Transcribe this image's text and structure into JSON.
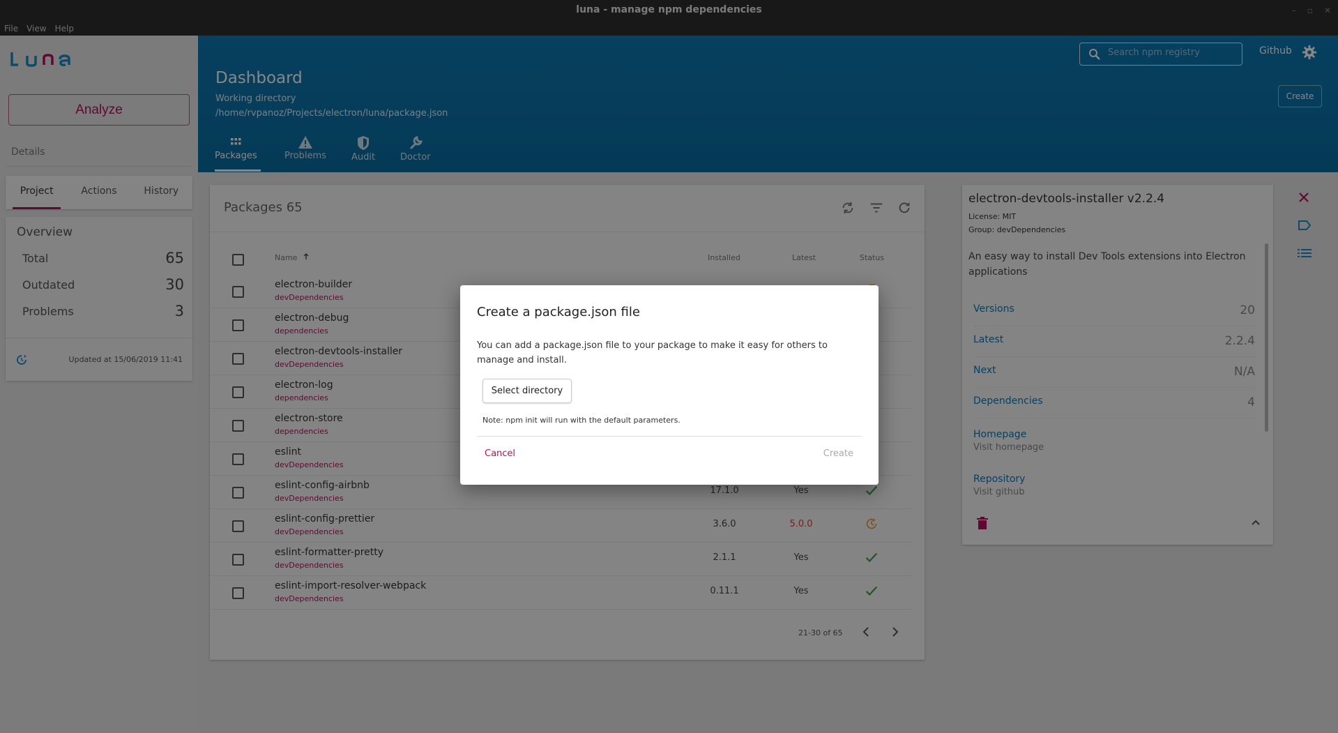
{
  "window": {
    "title": "luna - manage npm dependencies",
    "controls": [
      "–",
      "▫",
      "✕"
    ]
  },
  "menubar": {
    "items": [
      "File",
      "View",
      "Help"
    ]
  },
  "sidebar": {
    "logo": "Luna",
    "analyze_label": "Analyze",
    "details_label": "Details",
    "tabs": [
      {
        "label": "Project",
        "active": true
      },
      {
        "label": "Actions"
      },
      {
        "label": "History"
      }
    ],
    "overview": {
      "title": "Overview",
      "rows": [
        {
          "label": "Total",
          "value": "65"
        },
        {
          "label": "Outdated",
          "value": "30"
        },
        {
          "label": "Problems",
          "value": "3"
        }
      ],
      "updated": "Updated at 15/06/2019 11:41"
    }
  },
  "header": {
    "title": "Dashboard",
    "working_dir_label": "Working directory",
    "working_dir_path": "/home/rvpanoz/Projects/electron/luna/package.json",
    "search_placeholder": "Search npm registry",
    "github_label": "Github",
    "create_label": "Create",
    "tabs": [
      {
        "label": "Packages",
        "active": true
      },
      {
        "label": "Problems"
      },
      {
        "label": "Audit"
      },
      {
        "label": "Doctor"
      }
    ]
  },
  "packages": {
    "title": "Packages 65",
    "columns": {
      "name": "Name",
      "installed": "Installed",
      "latest": "Latest",
      "status": "Status"
    },
    "rows": [
      {
        "name": "electron-builder",
        "group": "devDependencies",
        "installed": "",
        "latest": "",
        "status": "outdated"
      },
      {
        "name": "electron-debug",
        "group": "dependencies",
        "installed": "",
        "latest": "",
        "status": "outdated"
      },
      {
        "name": "electron-devtools-installer",
        "group": "devDependencies",
        "installed": "",
        "latest": "",
        "status": "ok"
      },
      {
        "name": "electron-log",
        "group": "dependencies",
        "installed": "",
        "latest": "",
        "status": "outdated"
      },
      {
        "name": "electron-store",
        "group": "dependencies",
        "installed": "",
        "latest": "",
        "status": "outdated"
      },
      {
        "name": "eslint",
        "group": "devDependencies",
        "installed": "",
        "latest": "",
        "status": "ok"
      },
      {
        "name": "eslint-config-airbnb",
        "group": "devDependencies",
        "installed": "17.1.0",
        "latest": "Yes",
        "status": "ok"
      },
      {
        "name": "eslint-config-prettier",
        "group": "devDependencies",
        "installed": "3.6.0",
        "latest": "5.0.0",
        "status": "outdated"
      },
      {
        "name": "eslint-formatter-pretty",
        "group": "devDependencies",
        "installed": "2.1.1",
        "latest": "Yes",
        "status": "ok"
      },
      {
        "name": "eslint-import-resolver-webpack",
        "group": "devDependencies",
        "installed": "0.11.1",
        "latest": "Yes",
        "status": "ok"
      }
    ],
    "pager": "21-30 of 65"
  },
  "detail": {
    "title": "electron-devtools-installer v2.2.4",
    "license": "License: MIT",
    "group": "Group: devDependencies",
    "description": "An easy way to install Dev Tools extensions into Electron applications",
    "stats": [
      {
        "label": "Versions",
        "value": "20"
      },
      {
        "label": "Latest",
        "value": "2.2.4"
      },
      {
        "label": "Next",
        "value": "N/A"
      },
      {
        "label": "Dependencies",
        "value": "4"
      }
    ],
    "links": [
      {
        "label": "Homepage",
        "value": "Visit homepage"
      },
      {
        "label": "Repository",
        "value": "Visit github"
      }
    ]
  },
  "dialog": {
    "title": "Create a package.json file",
    "message": "You can add a package.json file to your package to make it easy for others to manage and install.",
    "select_label": "Select directory",
    "note": "Note: npm init will run with the default parameters.",
    "cancel_label": "Cancel",
    "create_label": "Create"
  },
  "colors": {
    "accent": "#b3125d",
    "header": "#0e79b4",
    "ok": "#43a047",
    "warn": "#f0a04b",
    "error": "#e53935"
  }
}
